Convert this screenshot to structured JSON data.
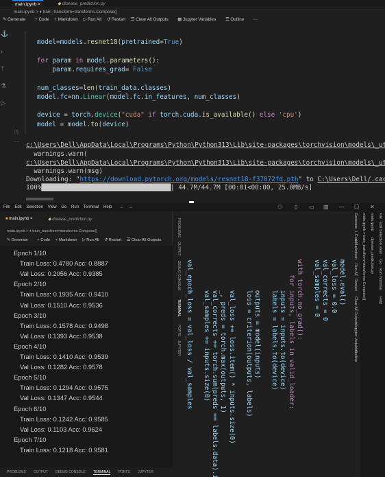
{
  "top": {
    "tabs": [
      "main.ipynb",
      "disease_prediction.py"
    ],
    "breadcrumb": "main.ipynb > ♦ train_transform=transforms.Compose([",
    "toolbar": [
      "Generate",
      "+ Code",
      "+ Markdown",
      "▷ Run All",
      "↺ Restart",
      "Clear All Outputs",
      "Jupyter Variables",
      "Outline",
      "···"
    ],
    "cell_number": "[7]",
    "code_lines": [
      [
        [
          "vr",
          "model"
        ],
        [
          "pl",
          "="
        ],
        [
          "vr",
          "models"
        ],
        [
          "pl",
          "."
        ],
        [
          "fn",
          "resnet18"
        ],
        [
          "pl",
          "("
        ],
        [
          "vr",
          "pretrained"
        ],
        [
          "pl",
          "="
        ],
        [
          "bl",
          "True"
        ],
        [
          "pl",
          ")"
        ]
      ],
      [],
      [
        [
          "kw",
          "for"
        ],
        [
          "pl",
          " "
        ],
        [
          "vr",
          "param"
        ],
        [
          "pl",
          " "
        ],
        [
          "kw",
          "in"
        ],
        [
          "pl",
          " "
        ],
        [
          "vr",
          "model"
        ],
        [
          "pl",
          "."
        ],
        [
          "fn",
          "parameters"
        ],
        [
          "pl",
          "():"
        ]
      ],
      [
        [
          "pl",
          "    "
        ],
        [
          "vr",
          "param"
        ],
        [
          "pl",
          "."
        ],
        [
          "vr",
          "requires_grad"
        ],
        [
          "pl",
          "= "
        ],
        [
          "bl",
          "False"
        ]
      ],
      [],
      [
        [
          "vr",
          "num_classes"
        ],
        [
          "pl",
          "="
        ],
        [
          "fn",
          "len"
        ],
        [
          "pl",
          "("
        ],
        [
          "vr",
          "train_data"
        ],
        [
          "pl",
          "."
        ],
        [
          "vr",
          "classes"
        ],
        [
          "pl",
          ")"
        ]
      ],
      [
        [
          "vr",
          "model"
        ],
        [
          "pl",
          "."
        ],
        [
          "vr",
          "fc"
        ],
        [
          "pl",
          "="
        ],
        [
          "vr",
          "nn"
        ],
        [
          "pl",
          "."
        ],
        [
          "ty",
          "Linear"
        ],
        [
          "pl",
          "("
        ],
        [
          "vr",
          "model"
        ],
        [
          "pl",
          "."
        ],
        [
          "vr",
          "fc"
        ],
        [
          "pl",
          "."
        ],
        [
          "vr",
          "in_features"
        ],
        [
          "pl",
          ", "
        ],
        [
          "vr",
          "num_classes"
        ],
        [
          "pl",
          ")"
        ]
      ],
      [],
      [
        [
          "vr",
          "device"
        ],
        [
          "pl",
          " = "
        ],
        [
          "vr",
          "torch"
        ],
        [
          "pl",
          "."
        ],
        [
          "ty",
          "device"
        ],
        [
          "pl",
          "("
        ],
        [
          "st",
          "\"cuda\""
        ],
        [
          "pl",
          " "
        ],
        [
          "kw",
          "if"
        ],
        [
          "pl",
          " "
        ],
        [
          "vr",
          "torch"
        ],
        [
          "pl",
          "."
        ],
        [
          "vr",
          "cuda"
        ],
        [
          "pl",
          "."
        ],
        [
          "fn",
          "is_available"
        ],
        [
          "pl",
          "() "
        ],
        [
          "kw",
          "else"
        ],
        [
          "pl",
          " "
        ],
        [
          "st",
          "'cpu'"
        ],
        [
          "pl",
          ")"
        ]
      ],
      [
        [
          "vr",
          "model"
        ],
        [
          "pl",
          " = "
        ],
        [
          "vr",
          "model"
        ],
        [
          "pl",
          "."
        ],
        [
          "fn",
          "to"
        ],
        [
          "pl",
          "("
        ],
        [
          "vr",
          "device"
        ],
        [
          "pl",
          ")"
        ]
      ]
    ],
    "output_lines": [
      {
        "t": "link",
        "text": "c:\\Users\\Dell\\AppData\\Local\\Programs\\Python\\Python313\\Lib\\site-packages\\torchvision\\models\\_utils."
      },
      {
        "t": "text",
        "text": "  warnings.warn("
      },
      {
        "t": "link",
        "text": "c:\\Users\\Dell\\AppData\\Local\\Programs\\Python\\Python313\\Lib\\site-packages\\torchvision\\models\\_utils."
      },
      {
        "t": "text",
        "text": "  warnings.warn(msg)"
      },
      {
        "t": "download",
        "pre": "Downloading: \"",
        "url": "https://download.pytorch.org/models/resnet18-f37072fd.pth",
        "mid": "\" to ",
        "path": "C:\\Users\\Dell/.cache\\t"
      },
      {
        "t": "progress",
        "pre": "100%",
        "bar": "█████████████████████████████████████",
        "post": "| 44.7M/44.7M [00:01<00:00, 25.0MB/s]",
        "progress": 1.0
      }
    ]
  },
  "bottom": {
    "menu": [
      "File",
      "Edit",
      "Selection",
      "View",
      "Go",
      "Run",
      "Terminal",
      "Help"
    ],
    "tabs": [
      "main.ipynb",
      "disease_prediction.py"
    ],
    "breadcrumb": "main.ipynb > ♦ train_transform=transforms.Compose([",
    "toolbar": [
      "Generate",
      "+ Code",
      "+ Markdown",
      "▷ Run All",
      "↺ Restart",
      "Clear All Outputs"
    ],
    "terminal_lines": [
      "Epoch 1/10",
      "Train Loss: 0.4780 Acc: 0.8887",
      "Val Loss: 0.2056 Acc: 0.9385",
      "Epoch 2/10",
      "Train Loss: 0.1935 Acc: 0.9410",
      "Val Loss: 0.1510 Acc: 0.9536",
      "Epoch 3/10",
      "Train Loss: 0.1578 Acc: 0.9498",
      "Val Loss: 0.1393 Acc: 0.9538",
      "Epoch 4/10",
      "Train Loss: 0.1410 Acc: 0.9539",
      "Val Loss: 0.1282 Acc: 0.9578",
      "Epoch 5/10",
      "Train Loss: 0.1294 Acc: 0.9575",
      "Val Loss: 0.1347 Acc: 0.9544",
      "Epoch 6/10",
      "Train Loss: 0.1242 Acc: 0.9585",
      "Val Loss: 0.1103 Acc: 0.9624",
      "Epoch 7/10",
      "Train Loss: 0.1218 Acc: 0.9581"
    ],
    "panel_tabs": [
      "PROBLEMS",
      "OUTPUT",
      "DEBUG CONSOLE",
      "TERMINAL",
      "PORTS",
      "JUPYTER"
    ],
    "vertical_panel_tabs": [
      "PROBLEMS",
      "OUTPUT",
      "DEBUG CONSOLE",
      "TERMINAL",
      "PORTS",
      "JUPYTER"
    ],
    "rotated_code": [
      "model.eval()",
      "val_loss = 0.0",
      "val_corrects = 0",
      "val_samples = 0",
      "",
      "with torch.no_grad():",
      "    for inputs, labels in valid_loader:",
      "        inputs = inputs.to(device)",
      "        labels = labels.to(device)",
      "",
      "        outputs = model(inputs)",
      "        loss = criterion(outputs, labels)",
      "",
      "        val_loss += loss.item() * inputs.size(0)",
      "        _, preds = torch.max(outputs, 1)",
      "        val_corrects += torch.sum(preds == labels.data).item()",
      "        val_samples += inputs.size(0)",
      "",
      "val_epoch_loss = val_loss / val_samples"
    ],
    "rotated_side": [
      "File",
      "Edit",
      "Selection",
      "View",
      "Go",
      "Run",
      "Terminal",
      "Help",
      "main.ipynb",
      "disease_prediction.py",
      "main.ipynb > train_transform=transforms.Compose([",
      "Generate",
      "+ Code",
      "+ Markdown",
      "Run All",
      "Restart",
      "Clear All Outputs",
      "Jupyter Variables",
      "Outline"
    ]
  }
}
